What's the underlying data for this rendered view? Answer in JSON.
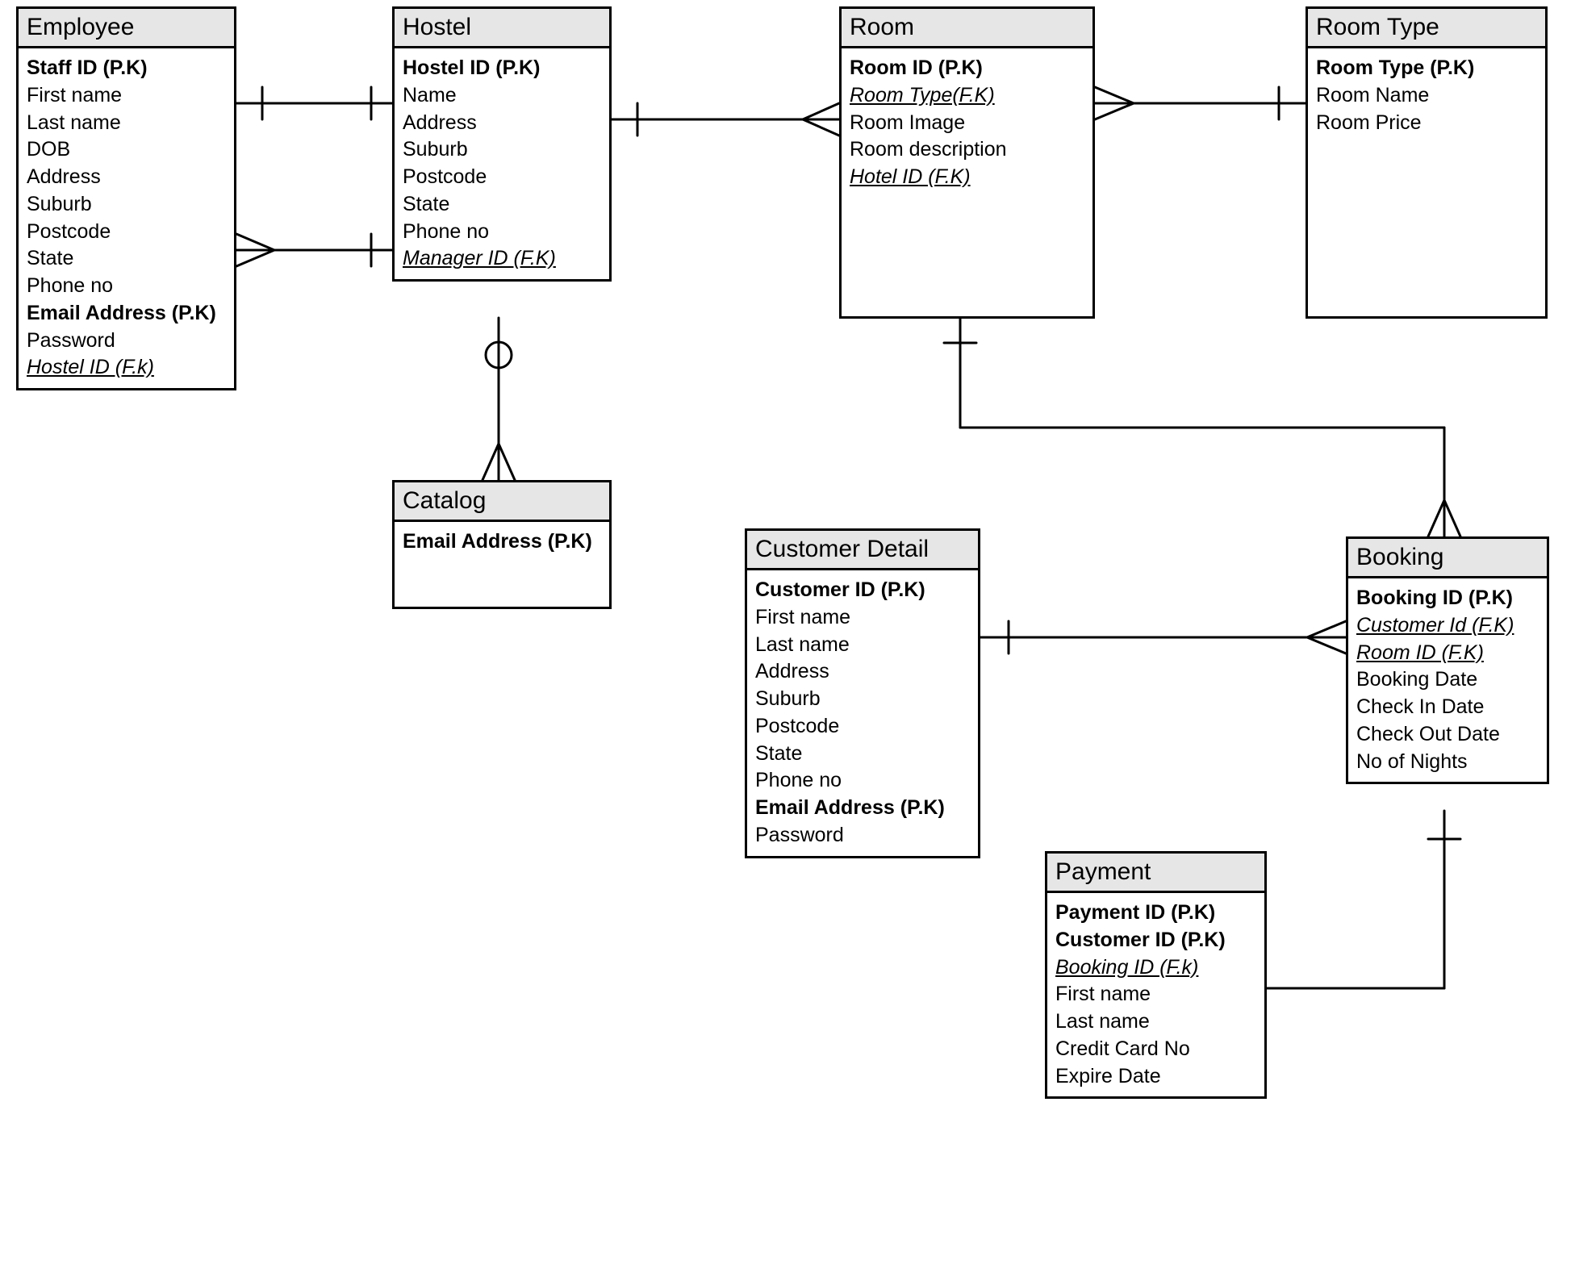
{
  "entities": {
    "employee": {
      "title": "Employee",
      "attrs": [
        {
          "t": "Staff ID (P.K)",
          "pk": true
        },
        {
          "t": "First name"
        },
        {
          "t": "Last name"
        },
        {
          "t": "DOB"
        },
        {
          "t": "Address"
        },
        {
          "t": "Suburb"
        },
        {
          "t": "Postcode"
        },
        {
          "t": "State"
        },
        {
          "t": "Phone no"
        },
        {
          "t": "Email Address (P.K)",
          "pk": true
        },
        {
          "t": "Password"
        },
        {
          "t": "Hostel ID (F.k)",
          "fk": true
        }
      ]
    },
    "hostel": {
      "title": "Hostel",
      "attrs": [
        {
          "t": "Hostel ID (P.K)",
          "pk": true
        },
        {
          "t": "Name"
        },
        {
          "t": "Address"
        },
        {
          "t": "Suburb"
        },
        {
          "t": "Postcode"
        },
        {
          "t": "State"
        },
        {
          "t": "Phone no"
        },
        {
          "t": "Manager ID (F.K)",
          "fk": true
        }
      ]
    },
    "catalog": {
      "title": "Catalog",
      "attrs": [
        {
          "t": "Email Address (P.K)",
          "pk": true
        }
      ]
    },
    "room": {
      "title": "Room",
      "attrs": [
        {
          "t": "Room ID (P.K)",
          "pk": true
        },
        {
          "t": "Room Type(F.K)",
          "fk": true
        },
        {
          "t": "Room Image"
        },
        {
          "t": "Room description"
        },
        {
          "t": "Hotel  ID (F.K)",
          "fk": true
        }
      ]
    },
    "roomtype": {
      "title": "Room Type",
      "attrs": [
        {
          "t": "Room Type (P.K)",
          "pk": true
        },
        {
          "t": "Room Name"
        },
        {
          "t": "Room Price"
        }
      ]
    },
    "customer": {
      "title": "Customer Detail",
      "attrs": [
        {
          "t": "Customer ID (P.K)",
          "pk": true
        },
        {
          "t": "First name"
        },
        {
          "t": "Last name"
        },
        {
          "t": "Address"
        },
        {
          "t": "Suburb"
        },
        {
          "t": "Postcode"
        },
        {
          "t": "State"
        },
        {
          "t": "Phone no"
        },
        {
          "t": "Email Address (P.K)",
          "pk": true
        },
        {
          "t": "Password"
        }
      ]
    },
    "booking": {
      "title": "Booking",
      "attrs": [
        {
          "t": "Booking ID (P.K)",
          "pk": true
        },
        {
          "t": "Customer Id (F.K)",
          "fk": true
        },
        {
          "t": "Room ID (F.K)",
          "fk": true
        },
        {
          "t": "Booking Date"
        },
        {
          "t": "Check In Date"
        },
        {
          "t": "Check Out Date"
        },
        {
          "t": "No of Nights"
        }
      ]
    },
    "payment": {
      "title": "Payment",
      "attrs": [
        {
          "t": "Payment ID (P.K)",
          "pk": true
        },
        {
          "t": "Customer ID (P.K)",
          "pk": true
        },
        {
          "t": "Booking ID (F.k)",
          "fk": true
        },
        {
          "t": "First name"
        },
        {
          "t": "Last name"
        },
        {
          "t": "Credit Card No"
        },
        {
          "t": "Expire Date"
        }
      ]
    }
  }
}
